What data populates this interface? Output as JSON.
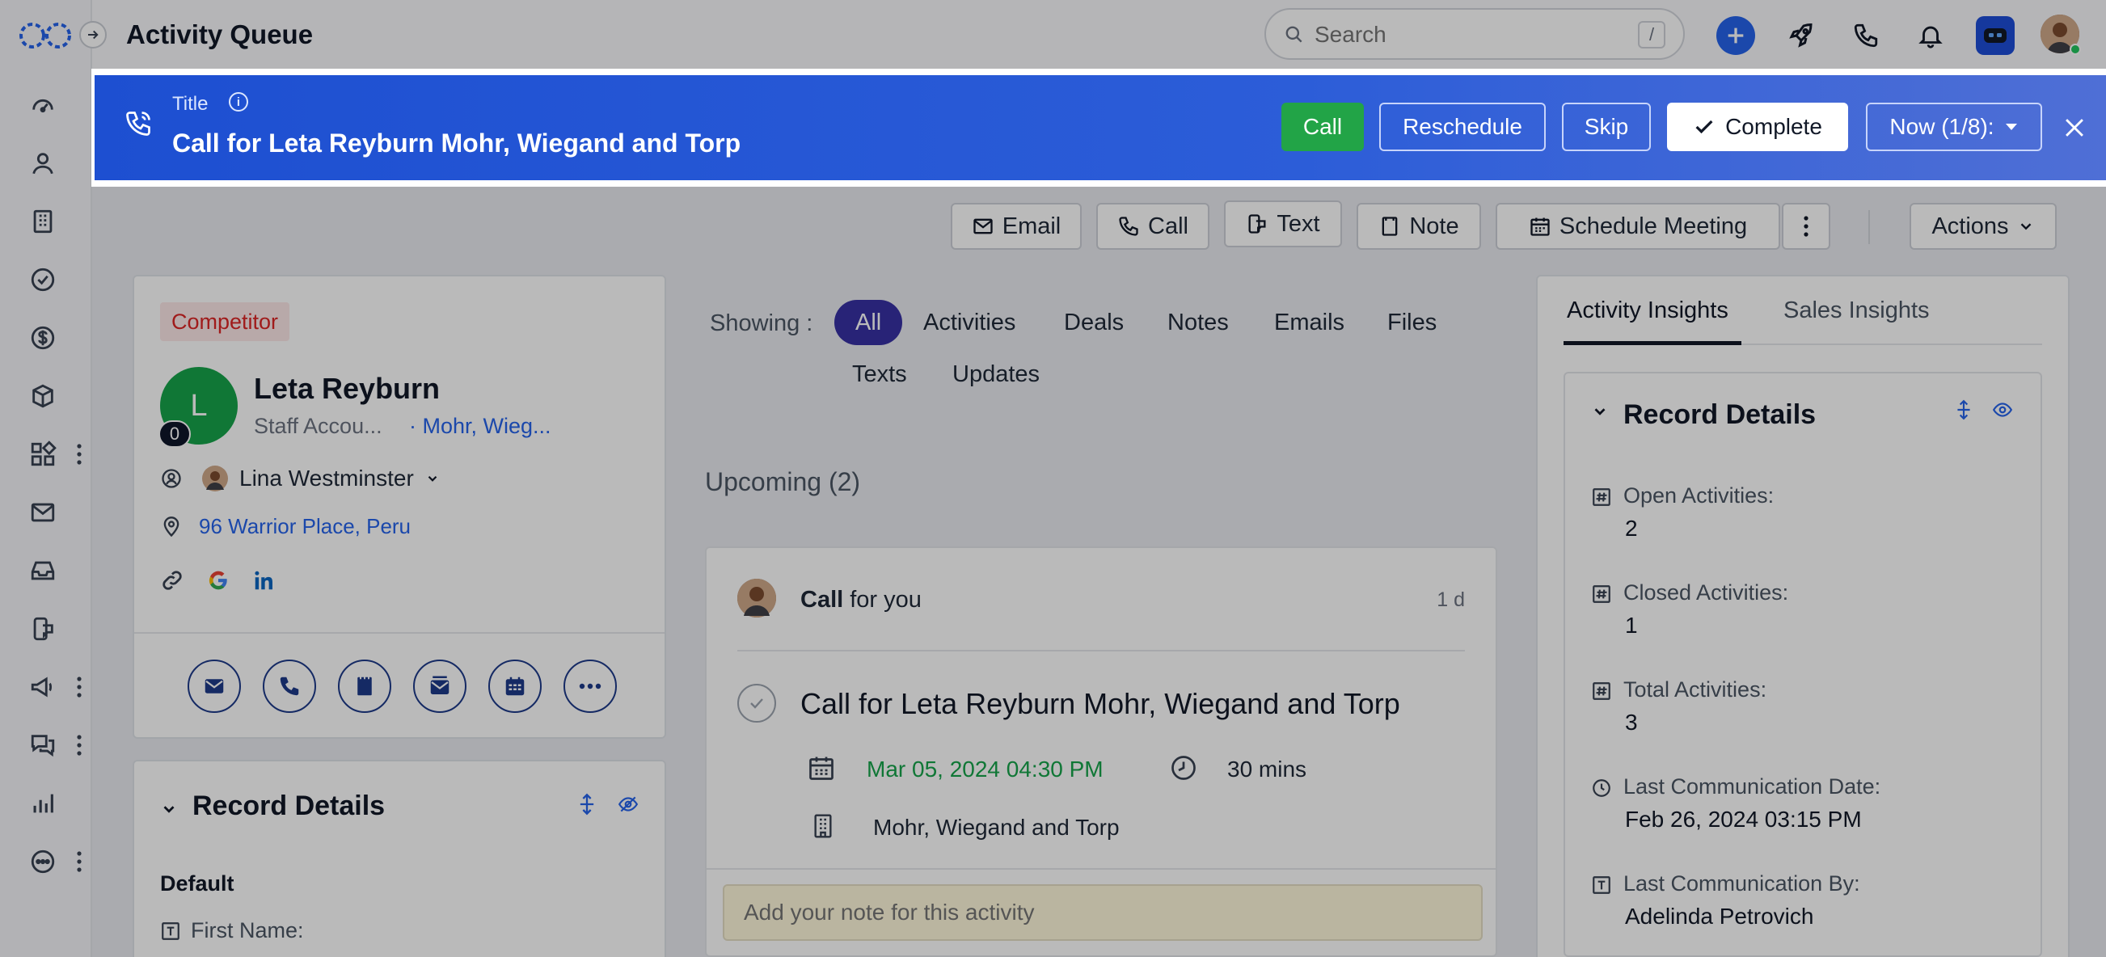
{
  "app": {
    "title": "Activity Queue"
  },
  "search": {
    "placeholder": "Search",
    "shortcut": "/"
  },
  "banner": {
    "label": "Title",
    "title": "Call for Leta Reyburn Mohr, Wiegand and Torp",
    "buttons": {
      "call": "Call",
      "reschedule": "Reschedule",
      "skip": "Skip",
      "complete": "Complete",
      "now": "Now (1/8):"
    }
  },
  "actions": {
    "email": "Email",
    "call": "Call",
    "text": "Text",
    "note": "Note",
    "schedule": "Schedule Meeting",
    "actions": "Actions"
  },
  "contact": {
    "tag": "Competitor",
    "initial": "L",
    "badge": "0",
    "name": "Leta Reyburn",
    "title": "Staff Accou...",
    "company": "· Mohr, Wieg...",
    "owner": "Lina Westminster",
    "address": "96 Warrior Place, Peru"
  },
  "record_details_left": {
    "title": "Record Details",
    "section": "Default",
    "field": "First Name:"
  },
  "filters": {
    "label": "Showing :",
    "items": [
      "All",
      "Activities",
      "Deals",
      "Notes",
      "Emails",
      "Files",
      "Texts",
      "Updates"
    ]
  },
  "timeline": {
    "upcoming": "Upcoming (2)",
    "activity": {
      "type": "Call",
      "for": " for you",
      "age": "1 d",
      "title": "Call for Leta Reyburn Mohr, Wiegand and Torp",
      "date": "Mar 05, 2024 04:30 PM",
      "duration": "30 mins",
      "company": "Mohr, Wiegand and Torp",
      "note_placeholder": "Add your note for this activity"
    }
  },
  "insights": {
    "tabs": [
      "Activity Insights",
      "Sales Insights"
    ],
    "title": "Record Details",
    "items": [
      {
        "label": "Open Activities:",
        "value": "2"
      },
      {
        "label": "Closed Activities:",
        "value": "1"
      },
      {
        "label": "Total Activities:",
        "value": "3"
      },
      {
        "label": "Last Communication Date:",
        "value": "Feb 26, 2024 03:15 PM"
      },
      {
        "label": "Last Communication By:",
        "value": "Adelinda Petrovich"
      }
    ]
  },
  "colors": {
    "banner": "#2c5dd8",
    "call_green": "#22a447",
    "filter_active": "#3730a3",
    "date_green": "#16a34a"
  }
}
